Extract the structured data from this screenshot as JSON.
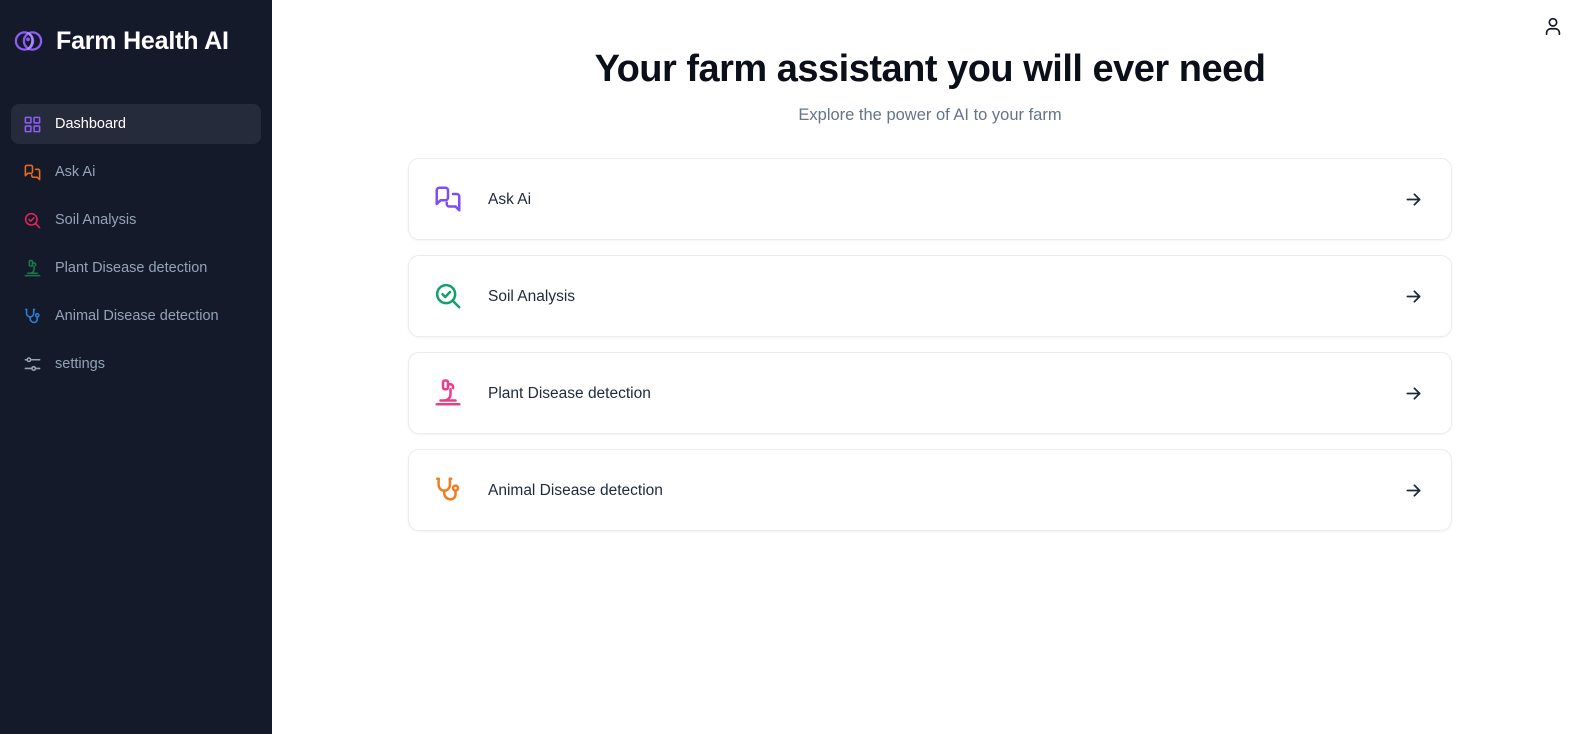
{
  "sidebar": {
    "brand": {
      "title": "Farm Health AI",
      "logo_icon": "farm-health-logo-icon",
      "logo_color": "#8b5cf6"
    },
    "items": [
      {
        "label": "Dashboard",
        "icon": "layout-grid-icon",
        "color": "#8b5cf6",
        "active": true
      },
      {
        "label": "Ask Ai",
        "icon": "message-square-icon",
        "color": "#ea6c1f",
        "active": false
      },
      {
        "label": "Soil Analysis",
        "icon": "search-check-icon",
        "color": "#e0245e",
        "active": false
      },
      {
        "label": "Plant Disease detection",
        "icon": "microscope-icon",
        "color": "#1b7a4a",
        "active": false
      },
      {
        "label": "Animal Disease detection",
        "icon": "stethoscope-icon",
        "color": "#2f7fd1",
        "active": false
      },
      {
        "label": "settings",
        "icon": "settings-sliders-icon",
        "color": "#94a3b8",
        "active": false
      }
    ]
  },
  "topbar": {
    "user_icon": "user-account-icon"
  },
  "hero": {
    "title": "Your farm assistant you will ever need",
    "subtitle": "Explore the power of AI to your farm"
  },
  "cards": [
    {
      "label": "Ask Ai",
      "icon": "message-square-icon",
      "color": "#7c4dff",
      "arrow_icon": "arrow-right-icon"
    },
    {
      "label": "Soil Analysis",
      "icon": "search-check-icon",
      "color": "#10a06a",
      "arrow_icon": "arrow-right-icon"
    },
    {
      "label": "Plant Disease detection",
      "icon": "microscope-icon",
      "color": "#ec3d8a",
      "arrow_icon": "arrow-right-icon"
    },
    {
      "label": "Animal Disease detection",
      "icon": "stethoscope-icon",
      "color": "#f47c20",
      "arrow_icon": "arrow-right-icon"
    }
  ],
  "colors": {
    "sidebar_bg": "#141a29",
    "sidebar_active_bg": "#252b3b",
    "main_bg": "#ffffff",
    "heading": "#0b0f1a",
    "subtitle": "#64748b",
    "card_border": "#ececef",
    "card_label": "#1e293b",
    "nav_label": "#94a3b8"
  }
}
